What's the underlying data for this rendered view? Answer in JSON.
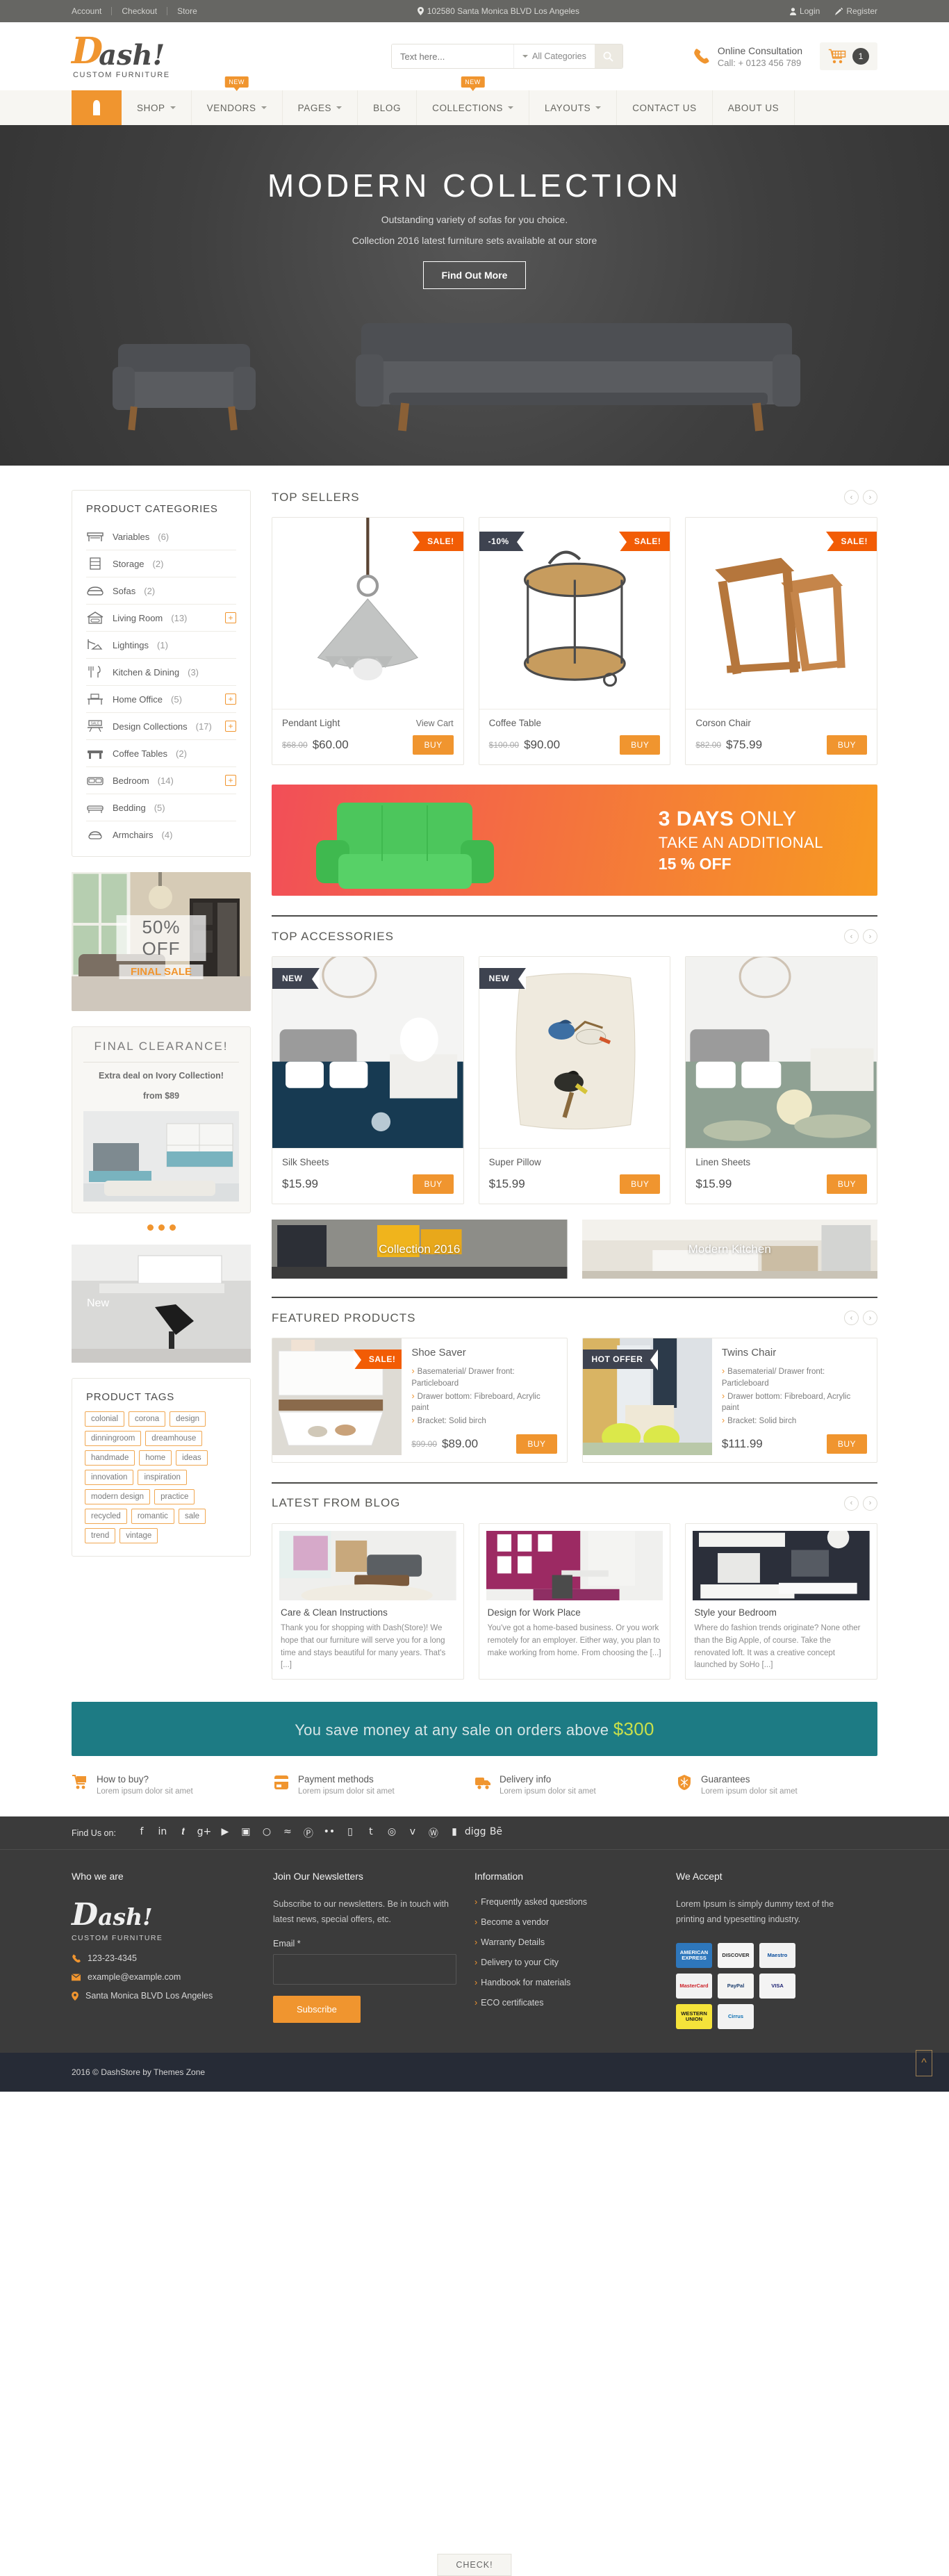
{
  "topbar": {
    "links": [
      "Account",
      "Checkout",
      "Store"
    ],
    "address": "102580 Santa Monica BLVD Los Angeles",
    "login": "Login",
    "register": "Register"
  },
  "header": {
    "logo_d": "D",
    "logo_ash": "ash!",
    "logo_sub": "CUSTOM FURNITURE",
    "search_placeholder": "Text here...",
    "search_category": "All Categories",
    "consult_title": "Online Consultation",
    "consult_phone": "Call: + 0123 456 789",
    "cart_count": "1"
  },
  "nav": {
    "items": [
      {
        "label": "SHOP",
        "caret": true,
        "badge": ""
      },
      {
        "label": "VENDORS",
        "caret": true,
        "badge": "NEW"
      },
      {
        "label": "PAGES",
        "caret": true,
        "badge": ""
      },
      {
        "label": "BLOG",
        "caret": false,
        "badge": ""
      },
      {
        "label": "COLLECTIONS",
        "caret": true,
        "badge": "NEW"
      },
      {
        "label": "LAYOUTS",
        "caret": true,
        "badge": ""
      },
      {
        "label": "CONTACT US",
        "caret": false,
        "badge": ""
      },
      {
        "label": "ABOUT US",
        "caret": false,
        "badge": ""
      }
    ]
  },
  "hero": {
    "title": "MODERN COLLECTION",
    "line1": "Outstanding variety of sofas for you choice.",
    "line2": "Collection 2016 latest furniture sets available at our store",
    "button": "Find Out More"
  },
  "sidebar": {
    "categories_title": "PRODUCT CATEGORIES",
    "categories": [
      {
        "label": "Variables",
        "count": "(6)",
        "expand": false,
        "icon": "desk-icon"
      },
      {
        "label": "Storage",
        "count": "(2)",
        "expand": false,
        "icon": "drawer-icon"
      },
      {
        "label": "Sofas",
        "count": "(2)",
        "expand": false,
        "icon": "sofa-icon"
      },
      {
        "label": "Living Room",
        "count": "(13)",
        "expand": true,
        "icon": "house-sofa-icon"
      },
      {
        "label": "Lightings",
        "count": "(1)",
        "expand": false,
        "icon": "lamp-icon"
      },
      {
        "label": "Kitchen & Dining",
        "count": "(3)",
        "expand": false,
        "icon": "cutlery-icon"
      },
      {
        "label": "Home Office",
        "count": "(5)",
        "expand": true,
        "icon": "office-desk-icon"
      },
      {
        "label": "Design Collections",
        "count": "(17)",
        "expand": true,
        "icon": "sale-sign-icon"
      },
      {
        "label": "Coffee Tables",
        "count": "(2)",
        "expand": false,
        "icon": "table-icon"
      },
      {
        "label": "Bedroom",
        "count": "(14)",
        "expand": true,
        "icon": "bed-icon"
      },
      {
        "label": "Bedding",
        "count": "(5)",
        "expand": false,
        "icon": "bedding-icon"
      },
      {
        "label": "Armchairs",
        "count": "(4)",
        "expand": false,
        "icon": "armchair-icon"
      }
    ],
    "banner1": {
      "big": "50% OFF",
      "small": "FINAL SALE"
    },
    "clearance": {
      "title": "FINAL CLEARANCE!",
      "line1": "Extra deal on Ivory Collection!",
      "line2": "from $89",
      "button": "CHECK!"
    },
    "banner2": {
      "label": "New"
    },
    "tags_title": "PRODUCT TAGS",
    "tags": [
      "colonial",
      "corona",
      "design",
      "dinningroom",
      "dreamhouse",
      "handmade",
      "home",
      "ideas",
      "innovation",
      "inspiration",
      "modern design",
      "practice",
      "recycled",
      "romantic",
      "sale",
      "trend",
      "vintage"
    ]
  },
  "top_sellers": {
    "title": "TOP SELLERS",
    "products": [
      {
        "name": "Pendant Light",
        "old_price": "$68.00",
        "price": "$60.00",
        "badge": "SALE!",
        "badge2": "",
        "view_cart": "View Cart",
        "buy": "BUY",
        "image": "pendant-light"
      },
      {
        "name": "Coffee Table",
        "old_price": "$100.00",
        "price": "$90.00",
        "badge": "SALE!",
        "badge2": "-10%",
        "view_cart": "",
        "buy": "BUY",
        "image": "coffee-table"
      },
      {
        "name": "Corson Chair",
        "old_price": "$82.00",
        "price": "$75.99",
        "badge": "SALE!",
        "badge2": "",
        "view_cart": "",
        "buy": "BUY",
        "image": "corson-chair"
      }
    ]
  },
  "promo": {
    "t1_bold": "3 DAYS",
    "t1_rest": " ONLY",
    "t2": "TAKE AN ADDITIONAL",
    "t3": "15 % OFF"
  },
  "top_accessories": {
    "title": "TOP ACCESSORIES",
    "products": [
      {
        "name": "Silk Sheets",
        "price": "$15.99",
        "badge": "NEW",
        "buy": "BUY",
        "image": "silk-sheets"
      },
      {
        "name": "Super Pillow",
        "price": "$15.99",
        "badge": "NEW",
        "buy": "BUY",
        "image": "super-pillow"
      },
      {
        "name": "Linen Sheets",
        "price": "$15.99",
        "badge": "",
        "buy": "BUY",
        "image": "linen-sheets"
      }
    ]
  },
  "collections": [
    {
      "label": "Collection 2016"
    },
    {
      "label": "Modern Kitchen"
    }
  ],
  "featured": {
    "title": "FEATURED PRODUCTS",
    "products": [
      {
        "name": "Shoe Saver",
        "badge": "SALE!",
        "badge_style": "orange",
        "features": [
          "Basematerial/ Drawer front: Particleboard",
          "Drawer bottom: Fibreboard, Acrylic paint",
          "Bracket: Solid birch"
        ],
        "old_price": "$99.00",
        "price": "$89.00",
        "buy": "BUY",
        "image": "shoe-saver"
      },
      {
        "name": "Twins Chair",
        "badge": "HOT OFFER",
        "badge_style": "dark",
        "features": [
          "Basematerial/ Drawer front: Particleboard",
          "Drawer bottom: Fibreboard, Acrylic paint",
          "Bracket: Solid birch"
        ],
        "old_price": "",
        "price": "$111.99",
        "buy": "BUY",
        "image": "twins-chair"
      }
    ]
  },
  "blog": {
    "title": "LATEST FROM BLOG",
    "posts": [
      {
        "title": "Care & Clean Instructions",
        "excerpt": "Thank you for shopping with Dash(Store)! We hope that our furniture will serve you for a long time and stays beautiful for many years. That's [...]",
        "image": "living-room"
      },
      {
        "title": "Design for Work Place",
        "excerpt": "You've got a home-based business. Or you work remotely for an employer. Either way, you plan to make working from home. From choosing the [...]",
        "image": "work-place"
      },
      {
        "title": "Style your Bedroom",
        "excerpt": "Where do fashion trends originate? None other than the Big Apple, of course. Take the renovated loft. It was a creative concept launched by SoHo [...]",
        "image": "bedroom"
      }
    ]
  },
  "teal_banner": {
    "text": "You save money at any sale on orders above ",
    "amount": "$300"
  },
  "features": [
    {
      "title": "How to buy?",
      "sub": "Lorem ipsum dolor sit amet",
      "icon": "cart-icon"
    },
    {
      "title": "Payment methods",
      "sub": "Lorem ipsum dolor sit amet",
      "icon": "credit-card-icon"
    },
    {
      "title": "Delivery info",
      "sub": "Lorem ipsum dolor sit amet",
      "icon": "truck-icon"
    },
    {
      "title": "Guarantees",
      "sub": "Lorem ipsum dolor sit amet",
      "icon": "shield-icon"
    }
  ],
  "social": {
    "label": "Find Us on:",
    "icons": [
      "f",
      "in",
      "𝒕",
      "g+",
      "▶",
      "▣",
      "○",
      "≈",
      "Ⓟ",
      "••",
      "▯",
      "t",
      "◎",
      "v",
      "Ⓦ",
      "▮",
      "digg",
      "Bē"
    ]
  },
  "footer": {
    "col1_title": "Who we are",
    "logo_d": "D",
    "logo_ash": "ash!",
    "logo_sub": "CUSTOM FURNITURE",
    "phone": "123-23-4345",
    "email": "example@example.com",
    "address": "Santa Monica BLVD Los Angeles",
    "col2_title": "Join Our Newsletters",
    "newsletter_desc": "Subscribe to our newsletters. Be in touch with latest news, special offers, etc.",
    "email_label": "Email *",
    "subscribe": "Subscribe",
    "col3_title": "Information",
    "links": [
      "Frequently asked questions",
      "Become a vendor",
      "Warranty Details",
      "Delivery to your City",
      "Handbook for materials",
      "ECO certificates"
    ],
    "col4_title": "We Accept",
    "accept_desc": "Lorem Ipsum is simply dummy text of the printing and typesetting industry.",
    "cards": [
      {
        "name": "AMERICAN EXPRESS",
        "bg": "#2e77bc",
        "fg": "#ffffff"
      },
      {
        "name": "DISCOVER",
        "bg": "#f5f5f5",
        "fg": "#2b2b2b"
      },
      {
        "name": "Maestro",
        "bg": "#f2f2f2",
        "fg": "#0a4d9c"
      },
      {
        "name": "MasterCard",
        "bg": "#f2f2f2",
        "fg": "#cc2229"
      },
      {
        "name": "PayPal",
        "bg": "#f4f4f2",
        "fg": "#1b3d6e"
      },
      {
        "name": "VISA",
        "bg": "#f4f4f4",
        "fg": "#1a1f71"
      },
      {
        "name": "WESTERN UNION",
        "bg": "#f5e33a",
        "fg": "#1a1a1a"
      },
      {
        "name": "Cirrus",
        "bg": "#f2f2f2",
        "fg": "#0b6fb3"
      }
    ],
    "copyright": "2016 © DashStore by Themes Zone"
  },
  "colors": {
    "accent": "#f0952f",
    "sale": "#f25c05",
    "dark": "#3e4350",
    "teal": "#1d7b84",
    "footer": "#3b3b3b"
  }
}
